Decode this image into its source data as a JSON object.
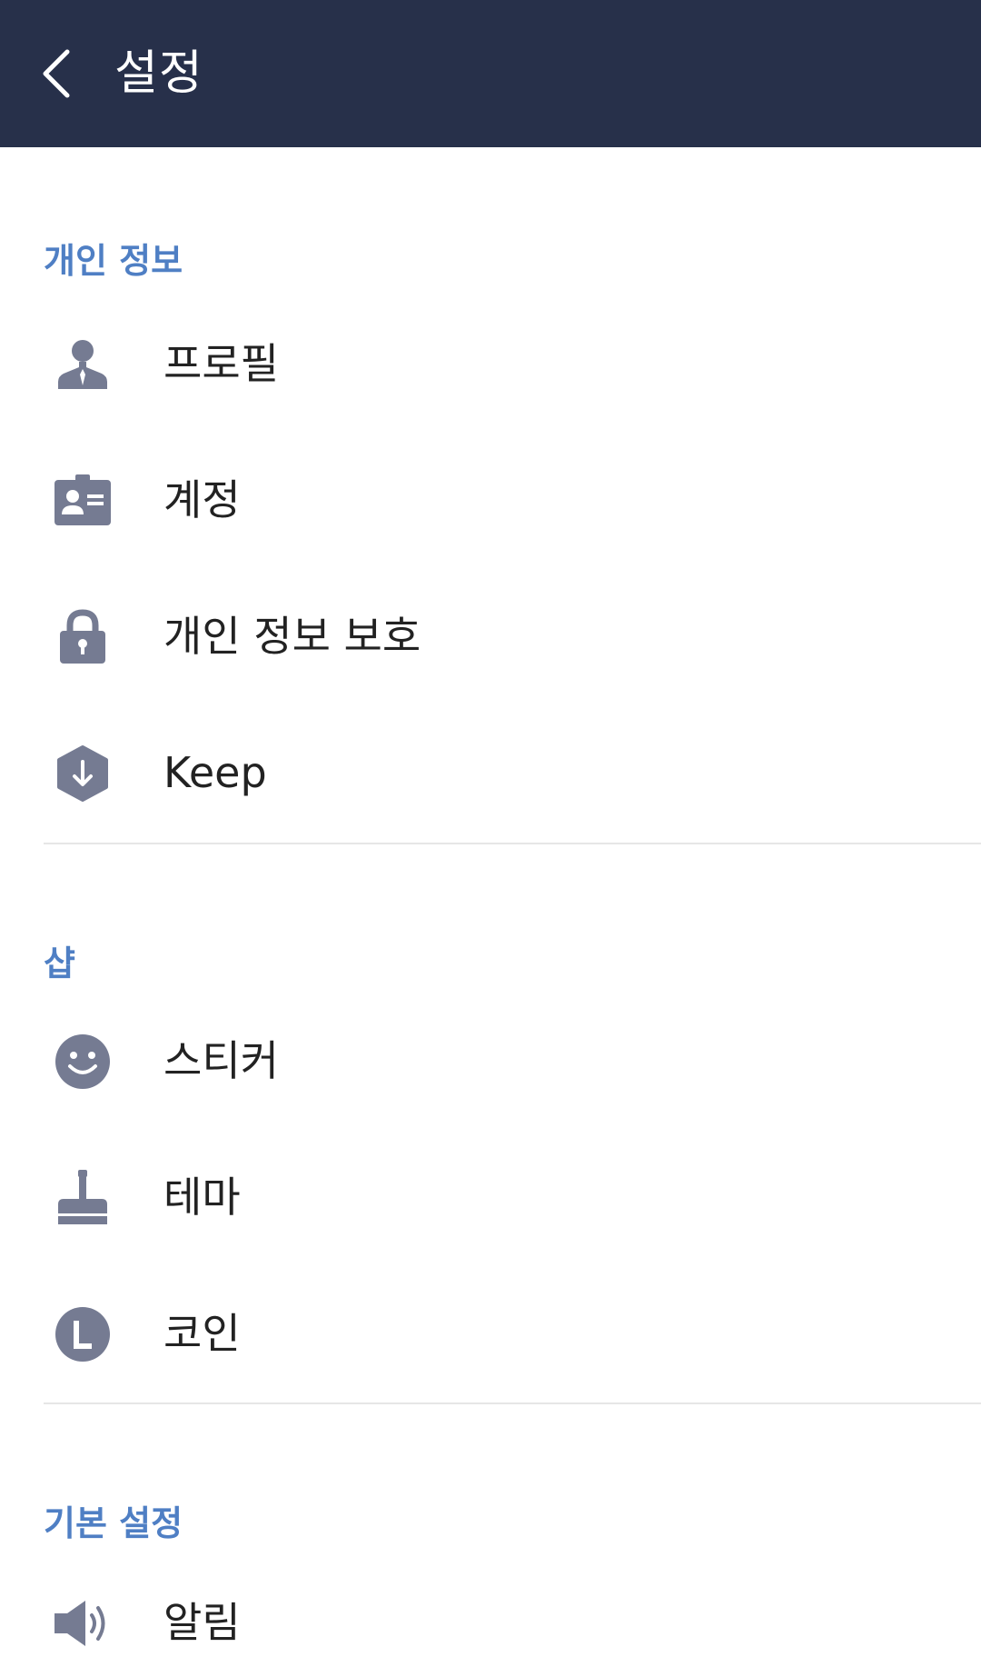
{
  "header": {
    "title": "설정",
    "back_icon": "chevron-left-icon",
    "background": "#27304a"
  },
  "accent_color": "#4f7fc4",
  "icon_color": "#757b92",
  "sections": [
    {
      "title": "개인 정보",
      "items": [
        {
          "label": "프로필",
          "icon": "profile-icon"
        },
        {
          "label": "계정",
          "icon": "id-card-icon"
        },
        {
          "label": "개인 정보 보호",
          "icon": "lock-icon"
        },
        {
          "label": "Keep",
          "icon": "keep-icon"
        }
      ]
    },
    {
      "title": "샵",
      "items": [
        {
          "label": "스티커",
          "icon": "smiley-icon"
        },
        {
          "label": "테마",
          "icon": "paint-brush-icon"
        },
        {
          "label": "코인",
          "icon": "coin-icon"
        }
      ]
    },
    {
      "title": "기본 설정",
      "items": [
        {
          "label": "알림",
          "icon": "speaker-icon"
        }
      ]
    }
  ]
}
